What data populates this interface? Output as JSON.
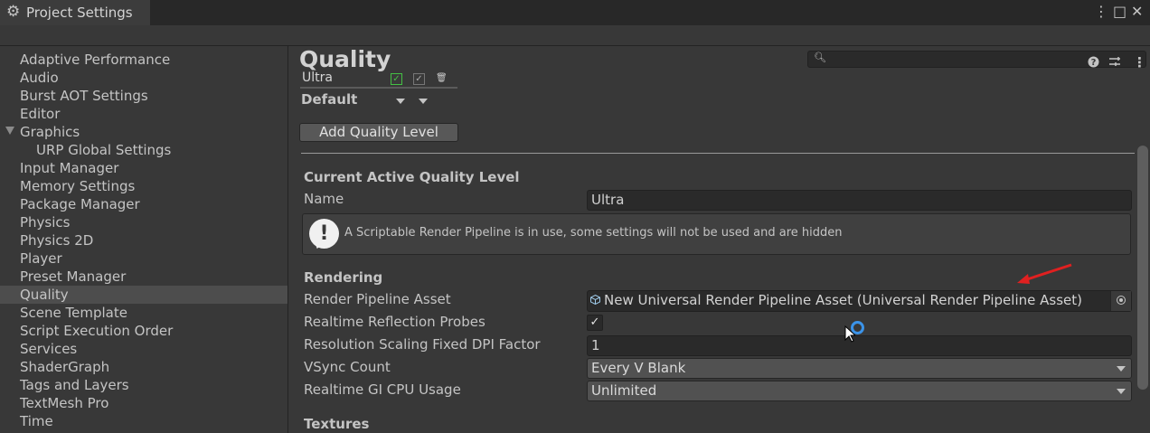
{
  "window": {
    "tab_title": "Project Settings",
    "tab_icon": "gear-icon",
    "controls": {
      "menu": "⋮",
      "maximize": "□",
      "close": "✕"
    }
  },
  "search": {
    "placeholder": "",
    "value": ""
  },
  "sidebar": {
    "items": [
      {
        "label": "Adaptive Performance"
      },
      {
        "label": "Audio"
      },
      {
        "label": "Burst AOT Settings"
      },
      {
        "label": "Editor"
      },
      {
        "label": "Graphics",
        "expanded": true
      },
      {
        "label": "URP Global Settings",
        "child": true
      },
      {
        "label": "Input Manager"
      },
      {
        "label": "Memory Settings"
      },
      {
        "label": "Package Manager"
      },
      {
        "label": "Physics"
      },
      {
        "label": "Physics 2D"
      },
      {
        "label": "Player"
      },
      {
        "label": "Preset Manager"
      },
      {
        "label": "Quality",
        "selected": true
      },
      {
        "label": "Scene Template"
      },
      {
        "label": "Script Execution Order"
      },
      {
        "label": "Services"
      },
      {
        "label": "ShaderGraph"
      },
      {
        "label": "Tags and Layers"
      },
      {
        "label": "TextMesh Pro"
      },
      {
        "label": "Time"
      }
    ]
  },
  "main": {
    "title": "Quality",
    "header_icons": [
      "help-icon",
      "preset-icon",
      "menu-icon"
    ],
    "quality_levels": {
      "row_label": "Ultra",
      "default_label": "Default"
    },
    "add_button": "Add Quality Level",
    "current_section": "Current Active Quality Level",
    "name_label": "Name",
    "name_value": "Ultra",
    "warning": "A Scriptable Render Pipeline is in use, some settings will not be used and are hidden",
    "rendering_section": "Rendering",
    "render_pipeline_label": "Render Pipeline Asset",
    "render_pipeline_value": "New Universal Render Pipeline Asset (Universal Render Pipeline Asset)",
    "reflection_label": "Realtime Reflection Probes",
    "reflection_checked": true,
    "dpi_label": "Resolution Scaling Fixed DPI Factor",
    "dpi_value": "1",
    "vsync_label": "VSync Count",
    "vsync_value": "Every V Blank",
    "gi_label": "Realtime GI CPU Usage",
    "gi_value": "Unlimited",
    "textures_section": "Textures"
  },
  "colors": {
    "background": "#383838",
    "titlebar": "#282828",
    "selected": "#4d4d4d",
    "field": "#2a2a2a",
    "annotation_arrow": "#e02020",
    "busy_indicator": "#3b93e8"
  }
}
